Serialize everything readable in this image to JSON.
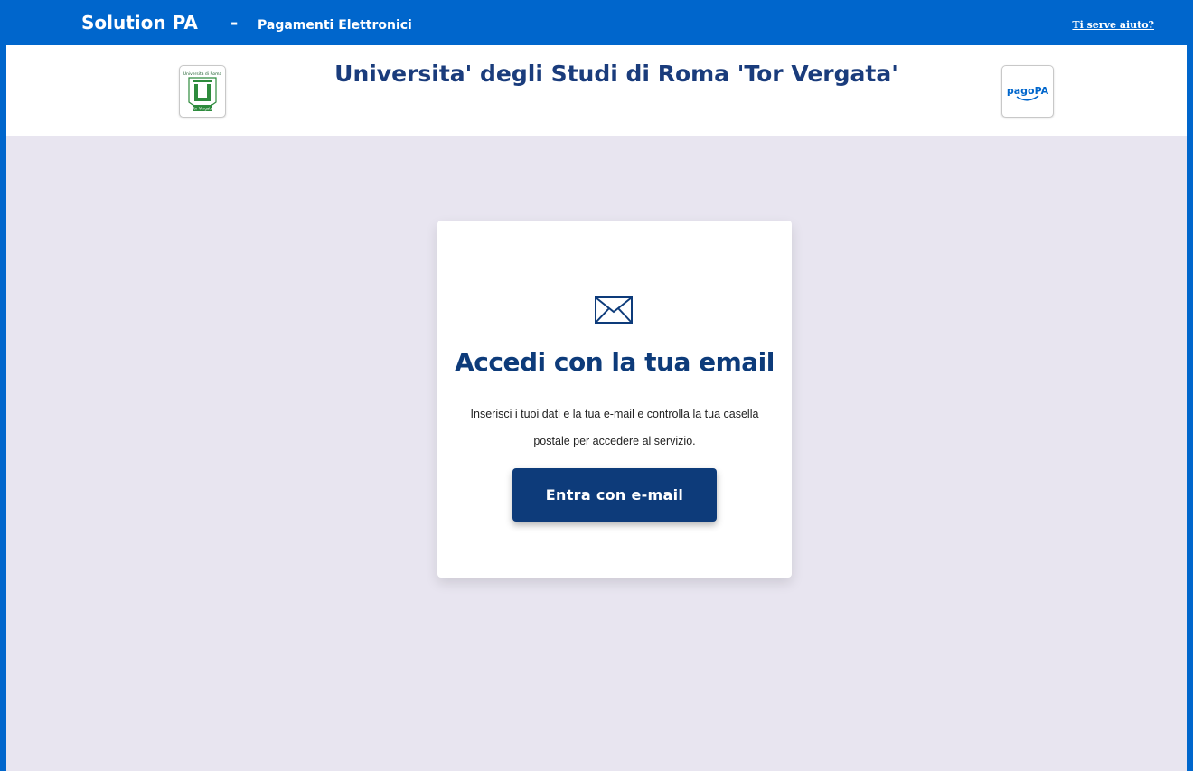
{
  "topbar": {
    "brand": "Solution PA",
    "separator": "-",
    "subtitle": "Pagamenti Elettronici",
    "help_link": "Ti serve aiuto?"
  },
  "header": {
    "title": "Universita' degli Studi di Roma 'Tor Vergata'",
    "left_logo": "university-logo",
    "left_logo_text_top": "Università di Roma",
    "left_logo_text_bottom": "Tor Vergata",
    "right_logo": "pagopa-logo",
    "right_logo_text": "pagoPA"
  },
  "login_card": {
    "icon": "envelope-icon",
    "title": "Accedi con la tua email",
    "description": "Inserisci i tuoi dati e la tua e-mail e controlla la tua casella postale per accedere al servizio.",
    "button_label": "Entra con e-mail"
  },
  "colors": {
    "topbar": "#0066cc",
    "page_background": "#e8e5f0",
    "title": "#1a3c7c",
    "button": "#0d3b7a"
  }
}
